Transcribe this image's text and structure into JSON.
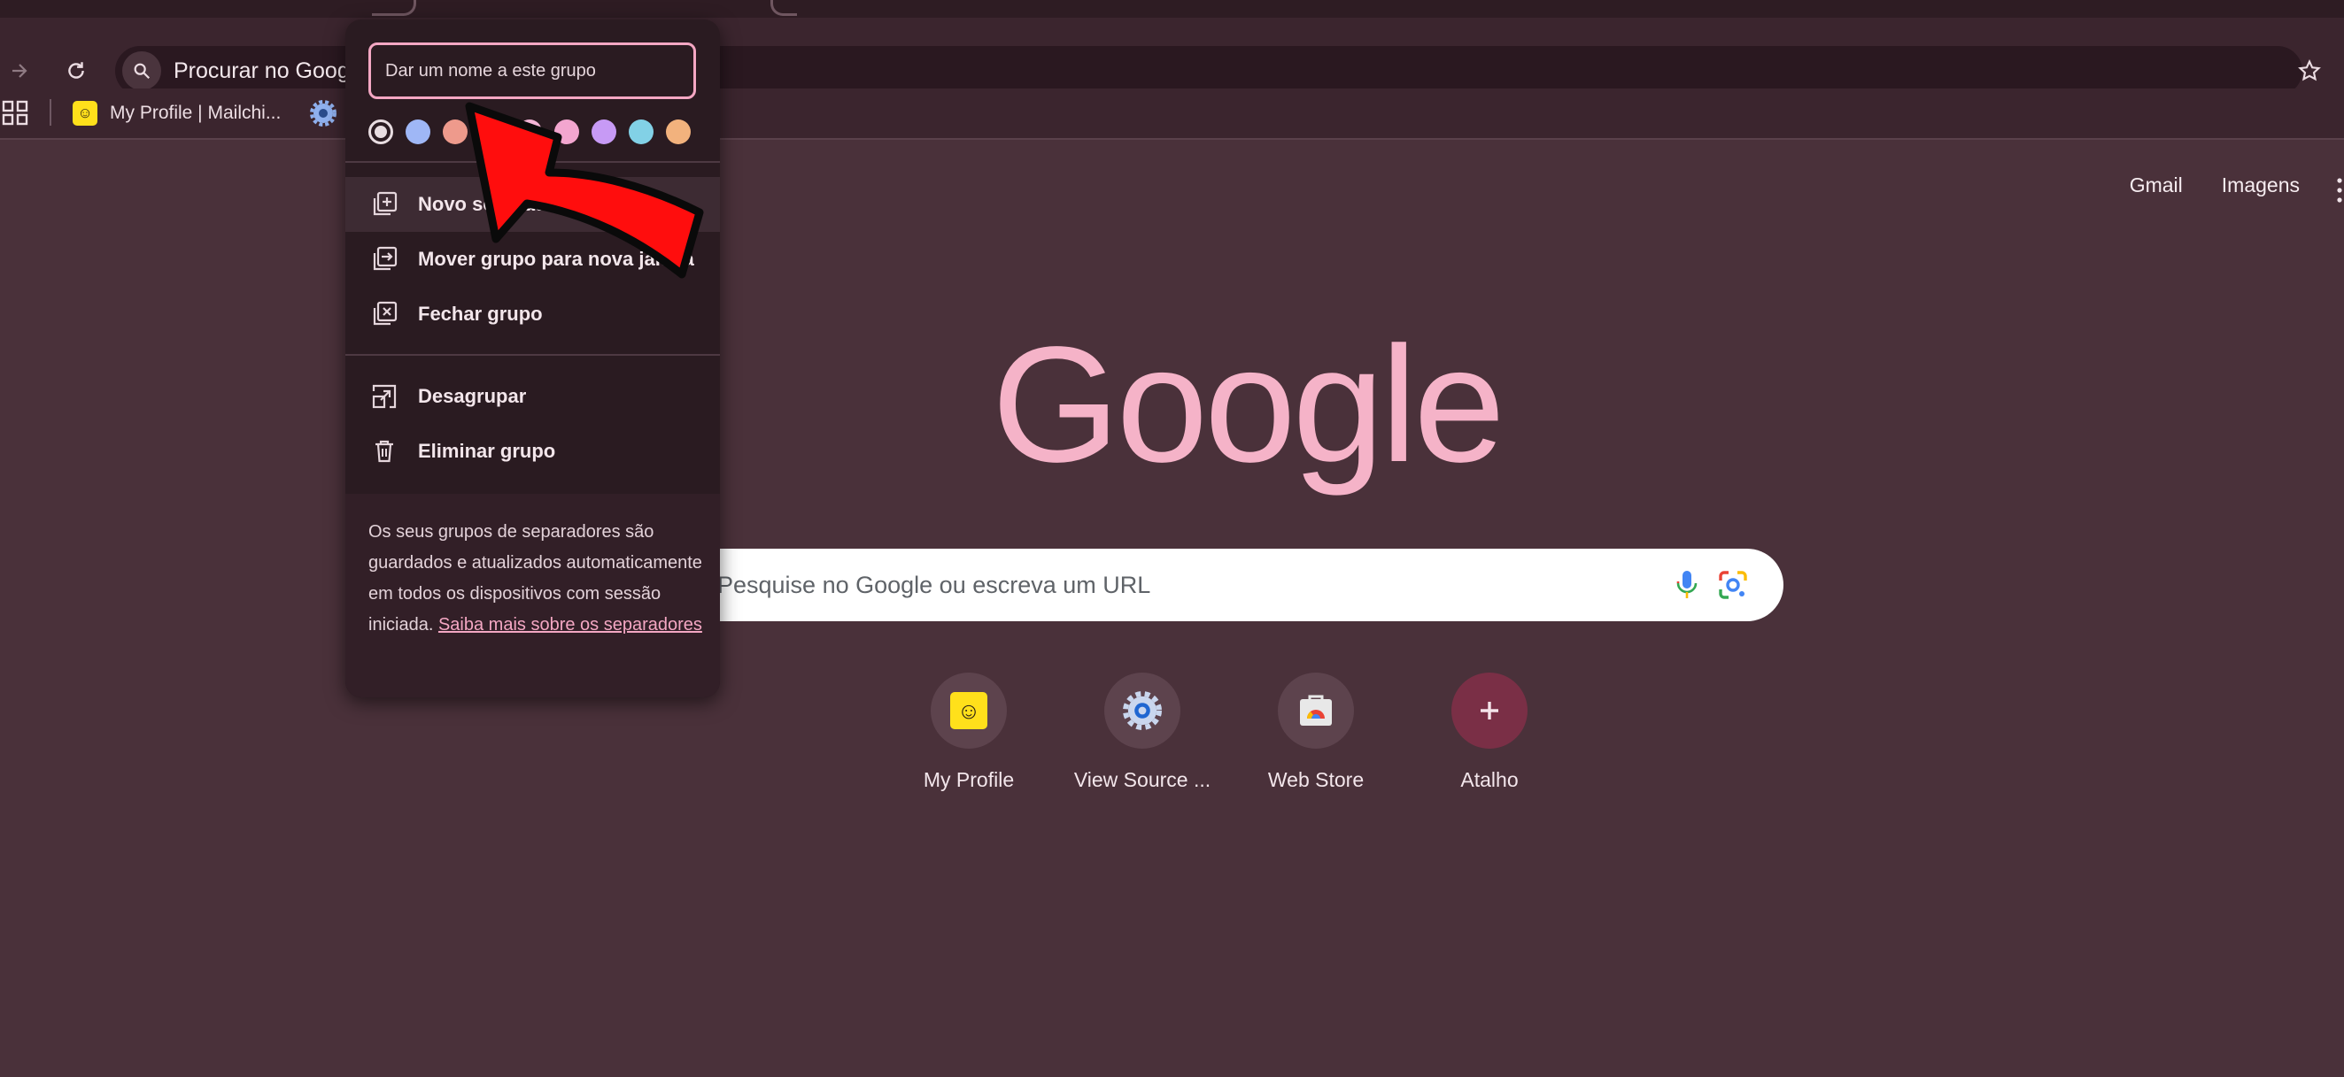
{
  "toolbar": {
    "omnibox_text": "Procurar no Goog"
  },
  "bookmarks": {
    "items": [
      {
        "label": "My Profile | Mailchi...",
        "icon": "mailchimp-icon"
      },
      {
        "label": "",
        "icon": "gear-icon"
      }
    ]
  },
  "ntp": {
    "top_links": {
      "gmail": "Gmail",
      "images": "Imagens"
    },
    "logo": "Google",
    "search_placeholder": "Pesquise no Google ou escreva um URL",
    "shortcuts": [
      {
        "label": "My Profile",
        "icon": "mailchimp-icon"
      },
      {
        "label": "View Source ...",
        "icon": "gear-icon"
      },
      {
        "label": "Web Store",
        "icon": "webstore-icon"
      },
      {
        "label": "Atalho",
        "icon": "plus-icon"
      }
    ]
  },
  "group_menu": {
    "name_placeholder": "Dar um nome a este grupo",
    "colors": [
      "#9fb7f6",
      "#ee9a8c",
      "#f3b5d6",
      "#f3a6cf",
      "#c79af5",
      "#82d1e6",
      "#f2b27d"
    ],
    "selected_color": "#e8dde1",
    "items": [
      {
        "label": "Novo separador",
        "icon": "new-tab-icon"
      },
      {
        "label": "Mover grupo para nova janela",
        "icon": "move-window-icon"
      },
      {
        "label": "Fechar grupo",
        "icon": "close-group-icon"
      },
      {
        "label": "Desagrupar",
        "icon": "ungroup-icon"
      },
      {
        "label": "Eliminar grupo",
        "icon": "trash-icon"
      }
    ],
    "footer_text": "Os seus grupos de separadores são guardados e atualizados automaticamente em todos os dispositivos com sessão iniciada.",
    "footer_link": "Saiba mais sobre os separadores"
  }
}
